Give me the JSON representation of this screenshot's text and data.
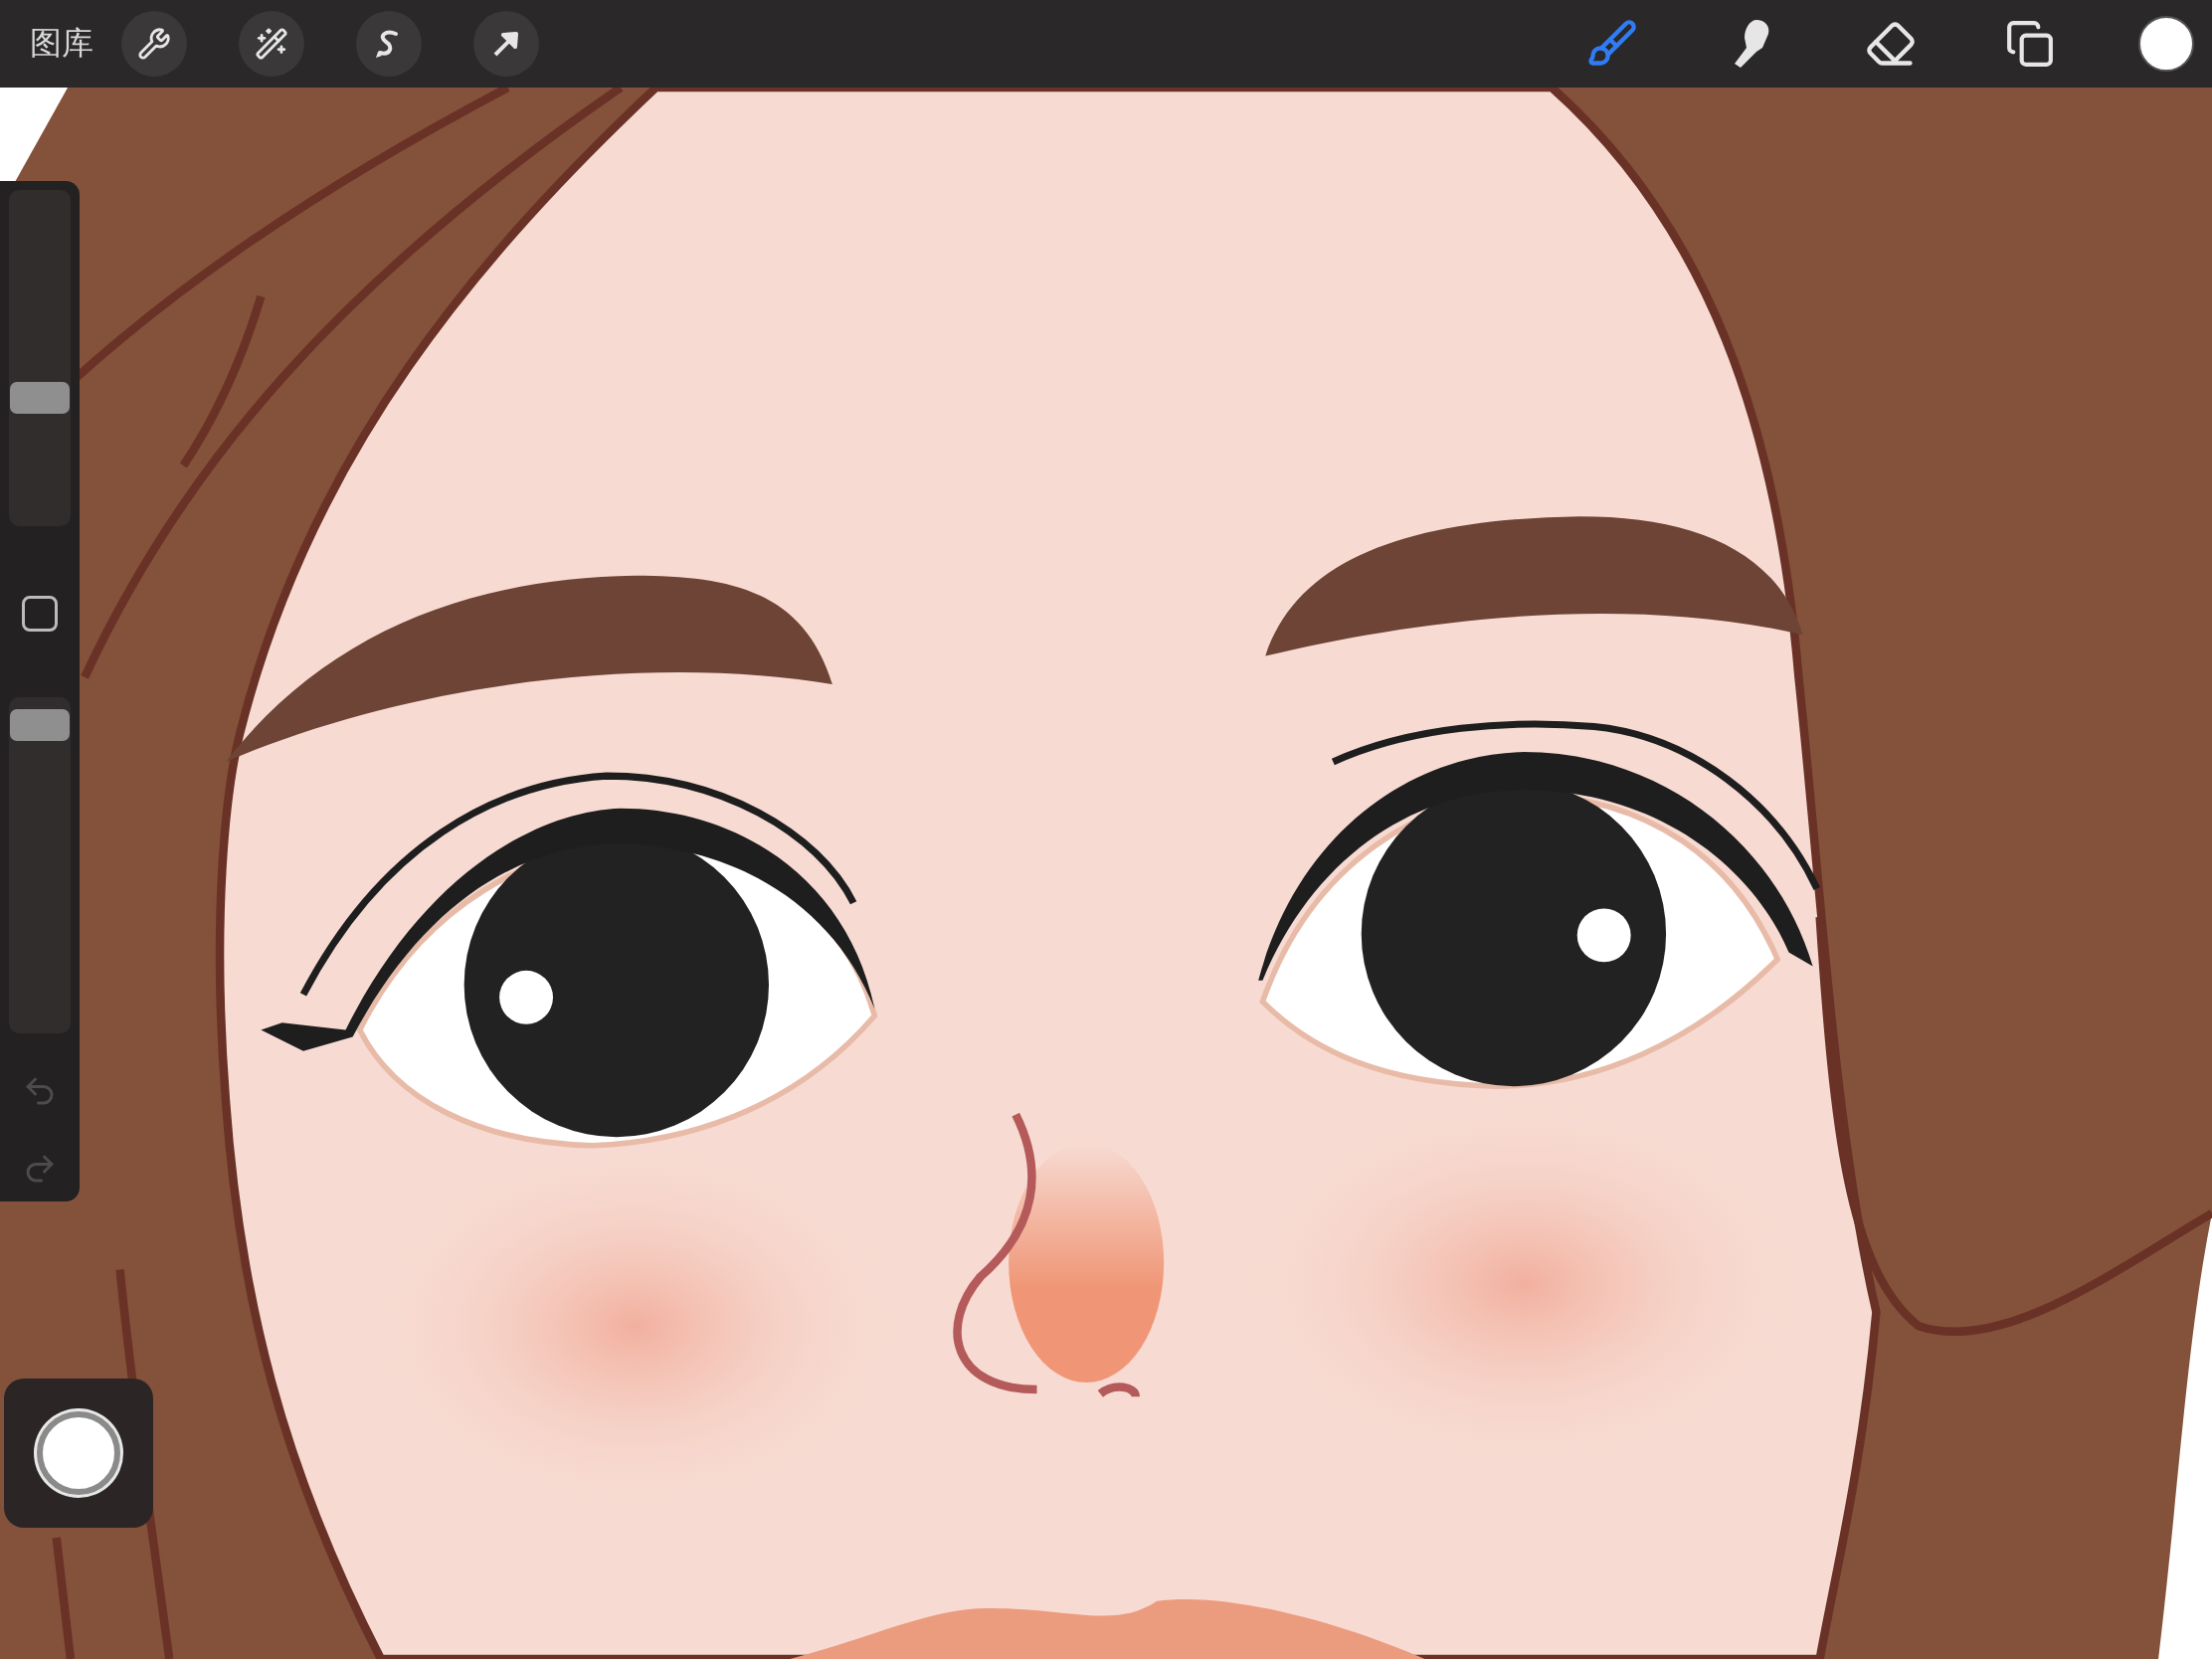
{
  "top_bar": {
    "gallery_label": "图库",
    "actions": [
      {
        "kind": "wrench"
      },
      {
        "kind": "wand"
      },
      {
        "kind": "selection"
      },
      {
        "kind": "transform"
      }
    ],
    "tools": [
      {
        "kind": "brush",
        "selected": true
      },
      {
        "kind": "smudge",
        "selected": false
      },
      {
        "kind": "eraser",
        "selected": false
      },
      {
        "kind": "layers",
        "selected": false
      }
    ],
    "color_swatch": {
      "color": "#ffffff"
    }
  },
  "sidebar": {
    "brush_size": {
      "level": 0.37
    },
    "opacity": {
      "level": 0.96
    },
    "undo": {
      "disabled": true
    },
    "redo": {
      "disabled": true
    }
  }
}
